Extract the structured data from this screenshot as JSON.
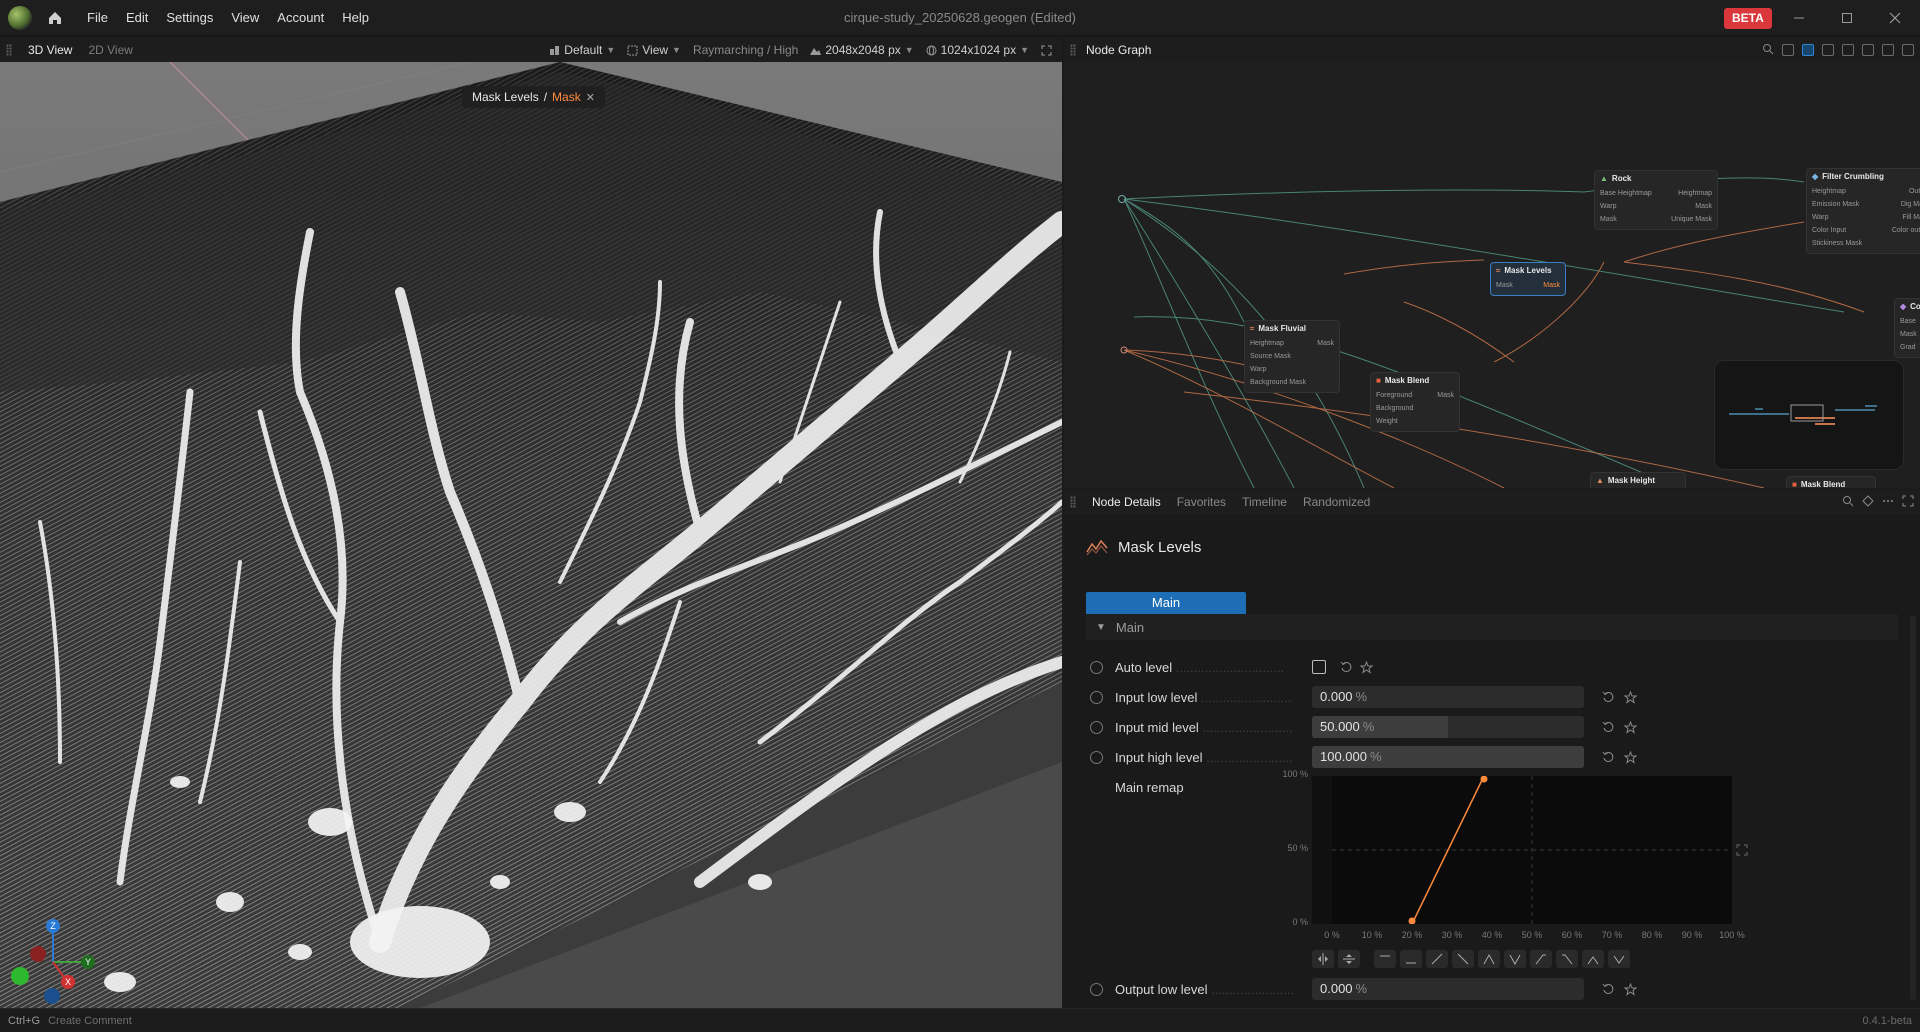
{
  "app": {
    "title": "cirque-study_20250628.geogen",
    "title_suffix": "(Edited)",
    "badge": "BETA",
    "menu": [
      "File",
      "Edit",
      "Settings",
      "View",
      "Account",
      "Help"
    ]
  },
  "viewport": {
    "tabs": [
      "3D View",
      "2D View"
    ],
    "active_tab": "3D View",
    "preset": "Default",
    "view_menu": "View",
    "render_mode": "Raymarching / High",
    "resolution_a": "2048x2048 px",
    "resolution_b": "1024x1024 px",
    "breadcrumb": {
      "node": "Mask Levels",
      "separator": "/",
      "output": "Mask"
    },
    "axes": {
      "x": "X",
      "y": "Y",
      "z": "Z"
    }
  },
  "node_graph": {
    "title": "Node Graph",
    "nodes": [
      {
        "title": "Rock",
        "rows": [
          [
            "Base Heightmap",
            "Heightmap"
          ],
          [
            "Warp",
            "Mask"
          ],
          [
            "Mask",
            "Unique Mask"
          ]
        ]
      },
      {
        "title": "Filter Crumbling",
        "rows": [
          [
            "Heightmap",
            "Output"
          ],
          [
            "Emission Mask",
            "Dig Mask"
          ],
          [
            "Warp",
            "Fill Mask"
          ],
          [
            "Color Input",
            "Color output"
          ],
          [
            "Stickiness Mask",
            ""
          ]
        ]
      },
      {
        "title": "Mask Levels",
        "rows": [
          [
            "Mask",
            "Mask"
          ]
        ]
      },
      {
        "title": "Mask Fluvial",
        "rows": [
          [
            "Heightmap",
            "Mask"
          ],
          [
            "Source Mask",
            ""
          ],
          [
            "Warp",
            ""
          ],
          [
            "Background Mask",
            ""
          ]
        ]
      },
      {
        "title": "Mask Blend",
        "rows": [
          [
            "Foreground",
            "Mask"
          ],
          [
            "Background",
            ""
          ],
          [
            "Weight",
            ""
          ]
        ]
      },
      {
        "title": "Col",
        "rows": [
          [
            "Base",
            ""
          ],
          [
            "Mask",
            ""
          ],
          [
            "Grad",
            ""
          ]
        ]
      },
      {
        "title": "Mask Height",
        "rows": []
      },
      {
        "title": "Mask Blend",
        "rows": []
      }
    ]
  },
  "details": {
    "tabs": [
      "Node Details",
      "Favorites",
      "Timeline",
      "Randomized"
    ],
    "active_tab": "Node Details",
    "node_title": "Mask Levels",
    "main_tab": "Main",
    "section": "Main",
    "params": [
      {
        "label": "Auto level",
        "type": "checkbox",
        "checked": false
      },
      {
        "label": "Input low level",
        "value": "0.000",
        "unit": "%",
        "fraction": 0.0
      },
      {
        "label": "Input mid level",
        "value": "50.000",
        "unit": "%",
        "fraction": 0.5
      },
      {
        "label": "Input high level",
        "value": "100.000",
        "unit": "%",
        "fraction": 1.0
      },
      {
        "label": "Main remap",
        "type": "curve"
      },
      {
        "label": "Output low level",
        "value": "0.000",
        "unit": "%",
        "fraction": 0.0
      }
    ],
    "curve": {
      "y_ticks": [
        "100 %",
        "50 %",
        "0 %"
      ],
      "x_ticks": [
        "0 %",
        "10 %",
        "20 %",
        "30 %",
        "40 %",
        "50 %",
        "60 %",
        "70 %",
        "80 %",
        "90 %",
        "100 %"
      ],
      "points": [
        [
          20,
          0
        ],
        [
          38,
          100
        ]
      ],
      "color": "#ff8a3d"
    }
  },
  "status": {
    "shortcut": "Ctrl+G",
    "hint": "Create Comment",
    "version": "0.4.1-beta"
  },
  "colors": {
    "accent": "#1d6eb5",
    "highlight": "#ff8a3d",
    "beta": "#d9373a"
  }
}
